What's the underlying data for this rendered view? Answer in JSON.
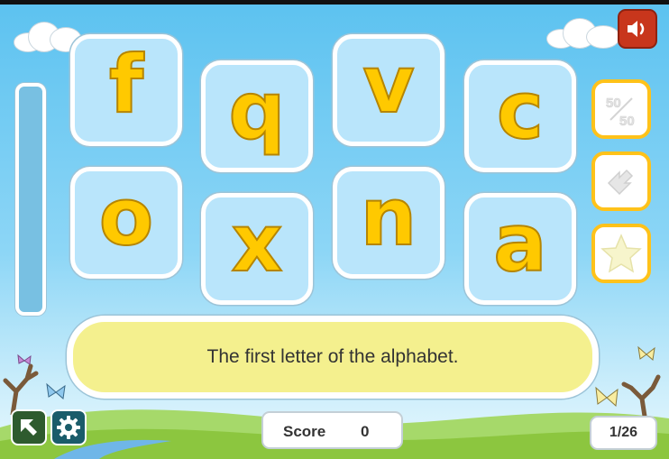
{
  "tiles": [
    {
      "letter": "f"
    },
    {
      "letter": "q"
    },
    {
      "letter": "v"
    },
    {
      "letter": "c"
    },
    {
      "letter": "o"
    },
    {
      "letter": "x"
    },
    {
      "letter": "n"
    },
    {
      "letter": "a"
    }
  ],
  "clue": "The first letter of the alphabet.",
  "score": {
    "label": "Score",
    "value": "0"
  },
  "question_counter": "1/26",
  "lifelines": {
    "fifty_fifty_label": "50/50",
    "swap_icon": "swap-arrows-icon",
    "star_icon": "star-icon"
  },
  "icons": {
    "sound": "speaker-icon",
    "exit": "exit-arrow-icon",
    "settings": "gear-icon"
  },
  "colors": {
    "tile_bg": "#b9e5fb",
    "letter": "#ffc900",
    "clue_bg": "#f4f08e",
    "lifeline_border": "#ffc21a",
    "sound_button": "#c8361c",
    "exit_button": "#2e5b2e",
    "settings_button": "#1a5c6a"
  }
}
